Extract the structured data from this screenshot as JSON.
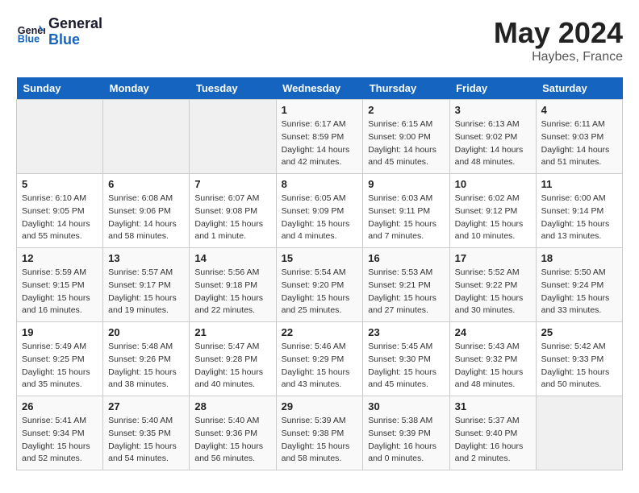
{
  "header": {
    "logo_line1": "General",
    "logo_line2": "Blue",
    "month": "May 2024",
    "location": "Haybes, France"
  },
  "weekdays": [
    "Sunday",
    "Monday",
    "Tuesday",
    "Wednesday",
    "Thursday",
    "Friday",
    "Saturday"
  ],
  "weeks": [
    [
      {
        "day": "",
        "info": ""
      },
      {
        "day": "",
        "info": ""
      },
      {
        "day": "",
        "info": ""
      },
      {
        "day": "1",
        "info": "Sunrise: 6:17 AM\nSunset: 8:59 PM\nDaylight: 14 hours\nand 42 minutes."
      },
      {
        "day": "2",
        "info": "Sunrise: 6:15 AM\nSunset: 9:00 PM\nDaylight: 14 hours\nand 45 minutes."
      },
      {
        "day": "3",
        "info": "Sunrise: 6:13 AM\nSunset: 9:02 PM\nDaylight: 14 hours\nand 48 minutes."
      },
      {
        "day": "4",
        "info": "Sunrise: 6:11 AM\nSunset: 9:03 PM\nDaylight: 14 hours\nand 51 minutes."
      }
    ],
    [
      {
        "day": "5",
        "info": "Sunrise: 6:10 AM\nSunset: 9:05 PM\nDaylight: 14 hours\nand 55 minutes."
      },
      {
        "day": "6",
        "info": "Sunrise: 6:08 AM\nSunset: 9:06 PM\nDaylight: 14 hours\nand 58 minutes."
      },
      {
        "day": "7",
        "info": "Sunrise: 6:07 AM\nSunset: 9:08 PM\nDaylight: 15 hours\nand 1 minute."
      },
      {
        "day": "8",
        "info": "Sunrise: 6:05 AM\nSunset: 9:09 PM\nDaylight: 15 hours\nand 4 minutes."
      },
      {
        "day": "9",
        "info": "Sunrise: 6:03 AM\nSunset: 9:11 PM\nDaylight: 15 hours\nand 7 minutes."
      },
      {
        "day": "10",
        "info": "Sunrise: 6:02 AM\nSunset: 9:12 PM\nDaylight: 15 hours\nand 10 minutes."
      },
      {
        "day": "11",
        "info": "Sunrise: 6:00 AM\nSunset: 9:14 PM\nDaylight: 15 hours\nand 13 minutes."
      }
    ],
    [
      {
        "day": "12",
        "info": "Sunrise: 5:59 AM\nSunset: 9:15 PM\nDaylight: 15 hours\nand 16 minutes."
      },
      {
        "day": "13",
        "info": "Sunrise: 5:57 AM\nSunset: 9:17 PM\nDaylight: 15 hours\nand 19 minutes."
      },
      {
        "day": "14",
        "info": "Sunrise: 5:56 AM\nSunset: 9:18 PM\nDaylight: 15 hours\nand 22 minutes."
      },
      {
        "day": "15",
        "info": "Sunrise: 5:54 AM\nSunset: 9:20 PM\nDaylight: 15 hours\nand 25 minutes."
      },
      {
        "day": "16",
        "info": "Sunrise: 5:53 AM\nSunset: 9:21 PM\nDaylight: 15 hours\nand 27 minutes."
      },
      {
        "day": "17",
        "info": "Sunrise: 5:52 AM\nSunset: 9:22 PM\nDaylight: 15 hours\nand 30 minutes."
      },
      {
        "day": "18",
        "info": "Sunrise: 5:50 AM\nSunset: 9:24 PM\nDaylight: 15 hours\nand 33 minutes."
      }
    ],
    [
      {
        "day": "19",
        "info": "Sunrise: 5:49 AM\nSunset: 9:25 PM\nDaylight: 15 hours\nand 35 minutes."
      },
      {
        "day": "20",
        "info": "Sunrise: 5:48 AM\nSunset: 9:26 PM\nDaylight: 15 hours\nand 38 minutes."
      },
      {
        "day": "21",
        "info": "Sunrise: 5:47 AM\nSunset: 9:28 PM\nDaylight: 15 hours\nand 40 minutes."
      },
      {
        "day": "22",
        "info": "Sunrise: 5:46 AM\nSunset: 9:29 PM\nDaylight: 15 hours\nand 43 minutes."
      },
      {
        "day": "23",
        "info": "Sunrise: 5:45 AM\nSunset: 9:30 PM\nDaylight: 15 hours\nand 45 minutes."
      },
      {
        "day": "24",
        "info": "Sunrise: 5:43 AM\nSunset: 9:32 PM\nDaylight: 15 hours\nand 48 minutes."
      },
      {
        "day": "25",
        "info": "Sunrise: 5:42 AM\nSunset: 9:33 PM\nDaylight: 15 hours\nand 50 minutes."
      }
    ],
    [
      {
        "day": "26",
        "info": "Sunrise: 5:41 AM\nSunset: 9:34 PM\nDaylight: 15 hours\nand 52 minutes."
      },
      {
        "day": "27",
        "info": "Sunrise: 5:40 AM\nSunset: 9:35 PM\nDaylight: 15 hours\nand 54 minutes."
      },
      {
        "day": "28",
        "info": "Sunrise: 5:40 AM\nSunset: 9:36 PM\nDaylight: 15 hours\nand 56 minutes."
      },
      {
        "day": "29",
        "info": "Sunrise: 5:39 AM\nSunset: 9:38 PM\nDaylight: 15 hours\nand 58 minutes."
      },
      {
        "day": "30",
        "info": "Sunrise: 5:38 AM\nSunset: 9:39 PM\nDaylight: 16 hours\nand 0 minutes."
      },
      {
        "day": "31",
        "info": "Sunrise: 5:37 AM\nSunset: 9:40 PM\nDaylight: 16 hours\nand 2 minutes."
      },
      {
        "day": "",
        "info": ""
      }
    ]
  ]
}
